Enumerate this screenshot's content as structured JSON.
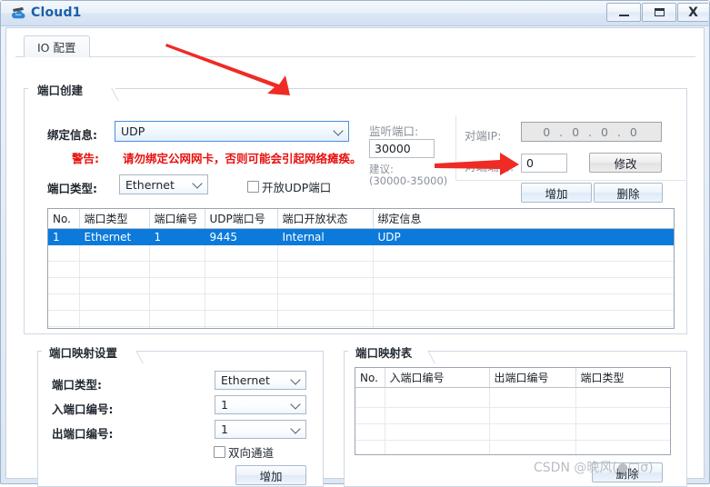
{
  "window": {
    "title": "Cloud1",
    "icon": "cloud-icon",
    "minimize_label": "–",
    "maximize_label": "□",
    "close_label": "X"
  },
  "tabs": [
    {
      "id": "io-config",
      "label": "IO 配置",
      "active": true
    }
  ],
  "port_create": {
    "group_title": "端口创建",
    "bind_info_label": "绑定信息:",
    "bind_info_value": "UDP",
    "warning_label": "警告:",
    "warning_text": "请勿绑定公网网卡，否则可能会引起网络瘫痪。",
    "warning_color": "#e8110f",
    "port_type_label": "端口类型:",
    "port_type_value": "Ethernet",
    "open_udp_checkbox_label": "开放UDP端口",
    "open_udp_checked": false,
    "listen_port_label": "监听端口:",
    "listen_port_value": "30000",
    "suggest_line1": "建议:",
    "suggest_line2": "(30000-35000)",
    "peer_ip_label": "对端IP:",
    "peer_ip_value": "0 . 0 . 0 . 0",
    "peer_ip_enabled": false,
    "peer_port_label": "对端端口:",
    "peer_port_value": "0",
    "modify_button": "修改",
    "add_button": "增加",
    "delete_button": "删除"
  },
  "port_table": {
    "columns": [
      "No.",
      "端口类型",
      "端口编号",
      "UDP端口号",
      "端口开放状态",
      "绑定信息"
    ],
    "rows": [
      {
        "selected": true,
        "cells": [
          "1",
          "Ethernet",
          "1",
          "9445",
          "Internal",
          "UDP"
        ]
      }
    ],
    "empty_row_count": 6
  },
  "map_settings": {
    "group_title": "端口映射设置",
    "port_type_label": "端口类型:",
    "port_type_value": "Ethernet",
    "in_port_label": "入端口编号:",
    "in_port_value": "1",
    "out_port_label": "出端口编号:",
    "out_port_value": "1",
    "bidirectional_label": "双向通道",
    "bidirectional_checked": false,
    "add_button": "增加"
  },
  "map_table": {
    "group_title": "端口映射表",
    "columns": [
      "No.",
      "入端口编号",
      "出端口编号",
      "端口类型"
    ],
    "rows": [],
    "empty_row_count": 4,
    "delete_button": "删除"
  },
  "annotations": {
    "arrow_color": "#ee2b24",
    "arrow_1_target": "bind-info-combo",
    "arrow_2_target": "add-button"
  },
  "watermark": {
    "text": "CSDN @晚风(●□σ)"
  }
}
